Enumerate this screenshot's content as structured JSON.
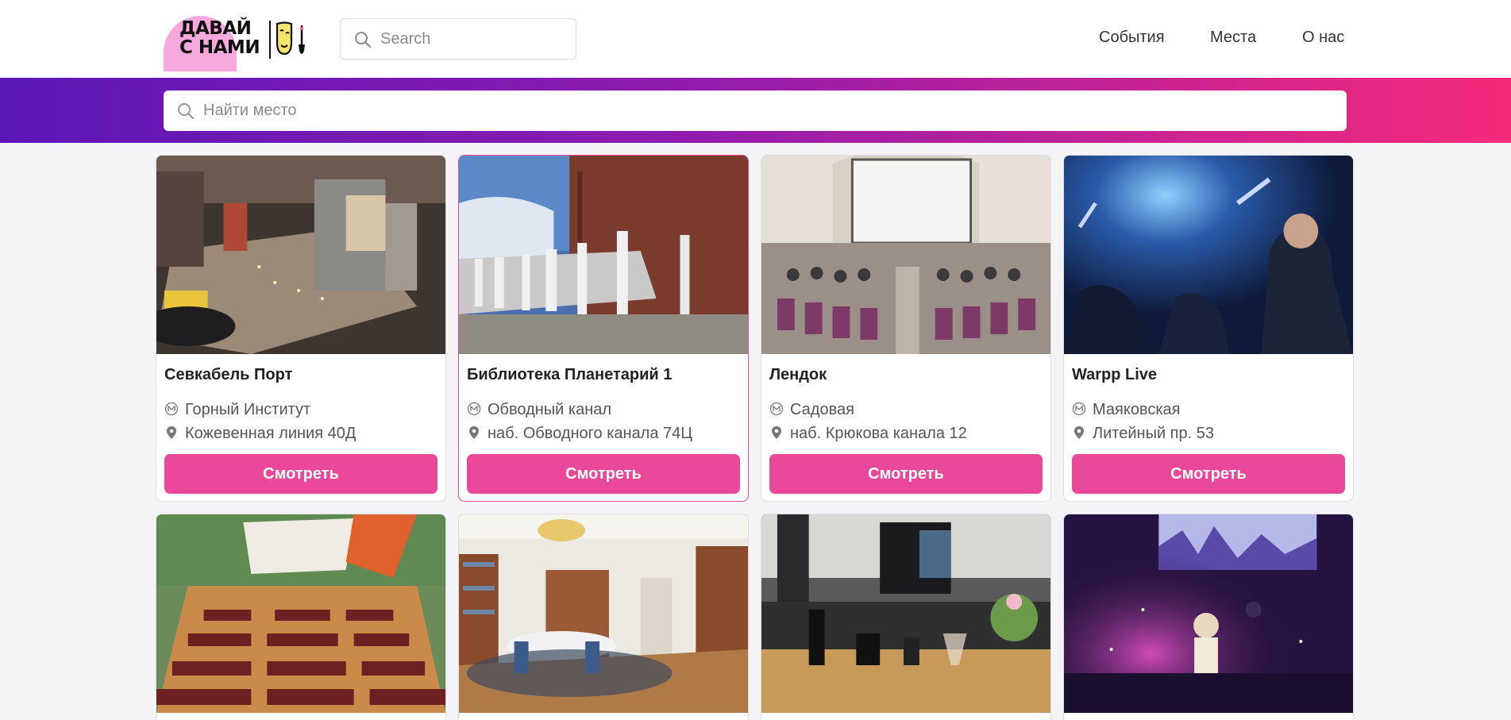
{
  "header": {
    "logo_text": "ДАВАЙ\nС НАМИ",
    "search_placeholder": "Search",
    "nav": [
      "События",
      "Места",
      "О нас"
    ]
  },
  "banner": {
    "search_placeholder": "Найти место"
  },
  "colors": {
    "accent": "#ea489a",
    "gradient_start": "#5b17b8",
    "gradient_end": "#f52a7a",
    "logo_pink": "#f7a8dc"
  },
  "places": [
    {
      "title": "Севкабель Порт",
      "metro": "Горный Институт",
      "address": "Кожевенная линия 40Д",
      "button": "Смотреть"
    },
    {
      "title": "Библиотека Планетарий 1",
      "metro": "Обводный канал",
      "address": "наб. Обводного канала 74Ц",
      "button": "Смотреть"
    },
    {
      "title": "Лендок",
      "metro": "Садовая",
      "address": "наб. Крюкова канала 12",
      "button": "Смотреть"
    },
    {
      "title": "Warpp Live",
      "metro": "Маяковская",
      "address": "Литейный пр. 53",
      "button": "Смотреть"
    }
  ],
  "icons": {
    "search": "search-icon",
    "metro": "metro-icon",
    "location": "location-pin-icon"
  }
}
